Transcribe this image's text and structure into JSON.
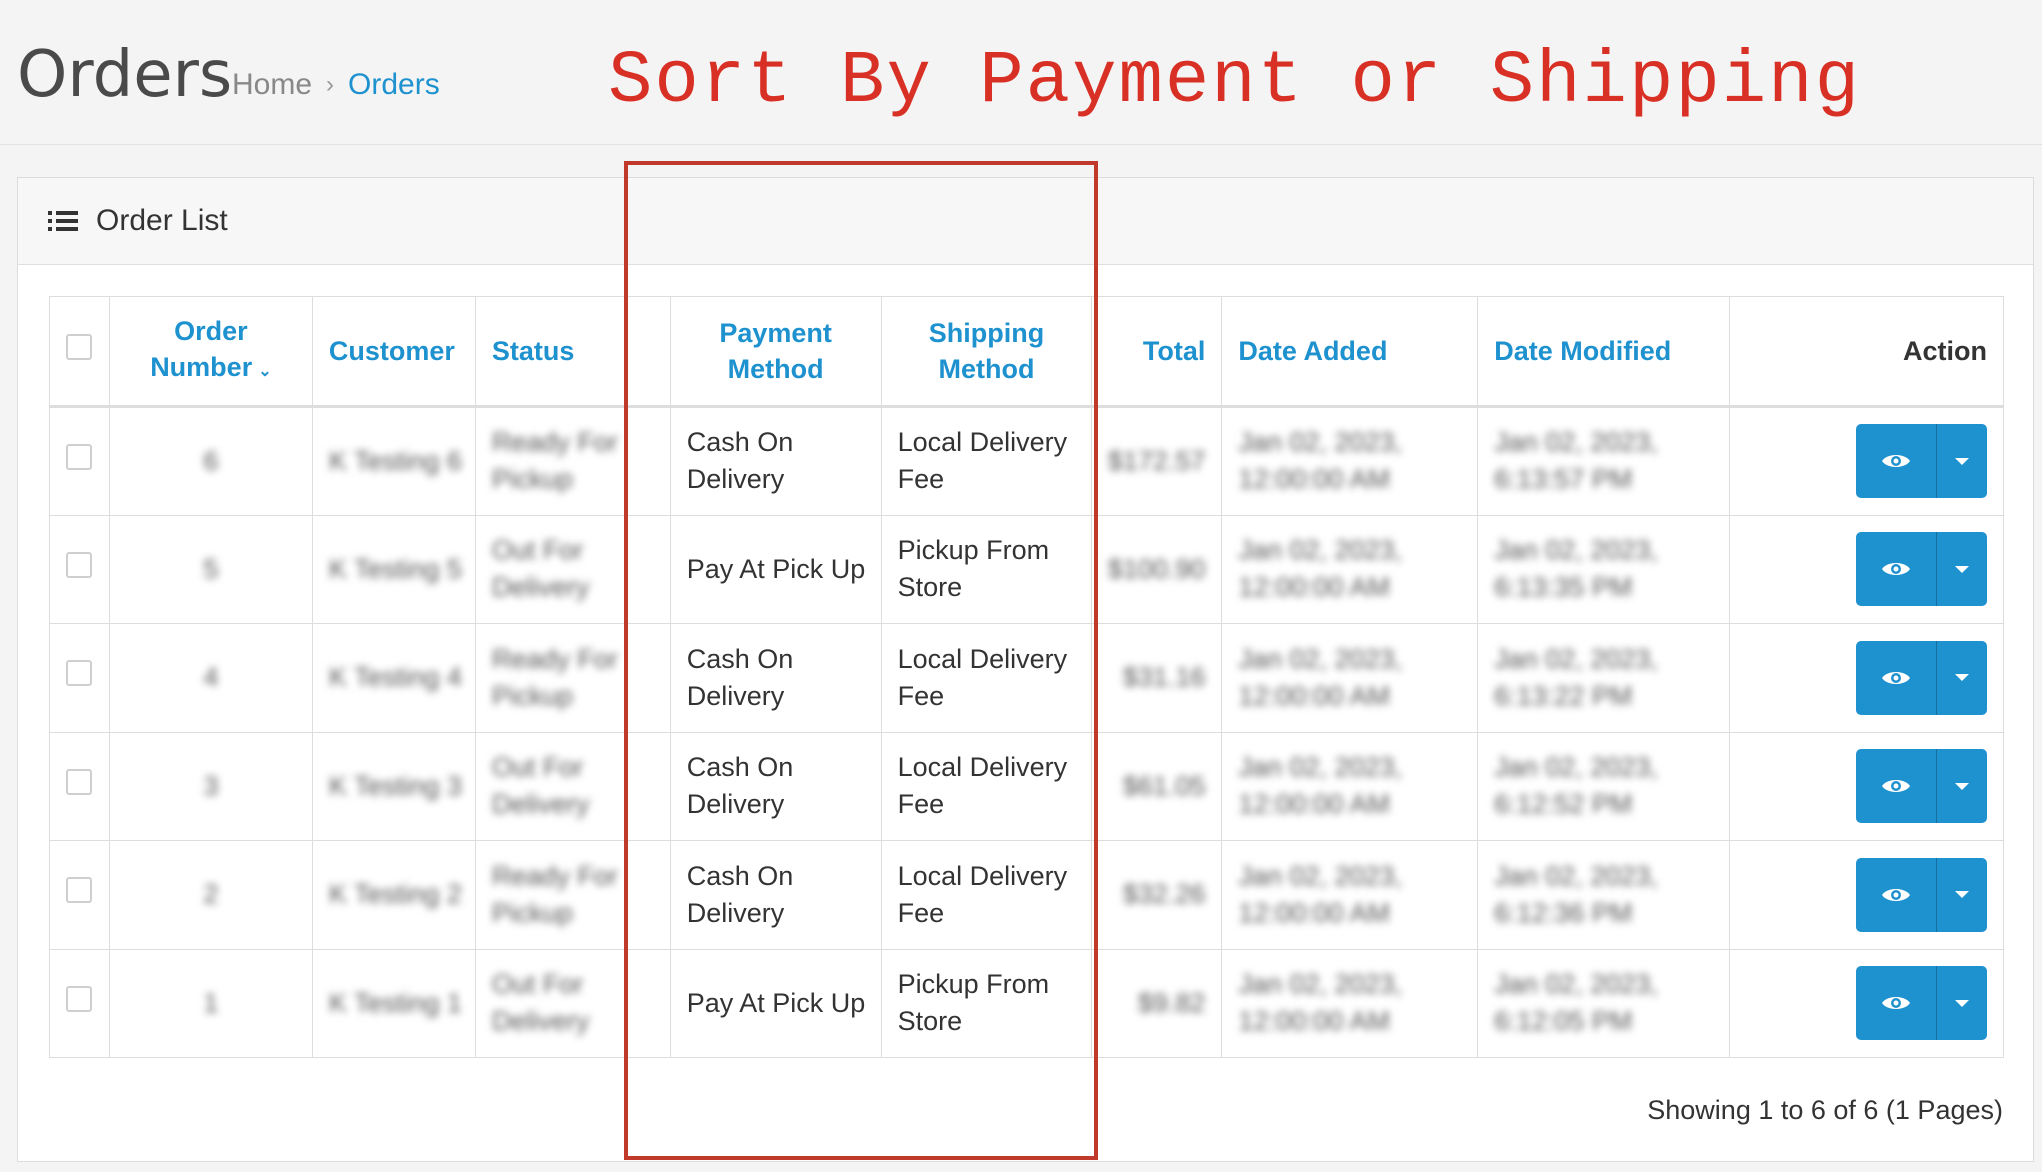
{
  "header": {
    "title": "Orders",
    "breadcrumb": [
      {
        "label": "Home"
      },
      {
        "label": "Orders"
      }
    ],
    "breadcrumb_separator": "›"
  },
  "annotation": {
    "text": "Sort By Payment or Shipping",
    "color": "#d93025"
  },
  "panel": {
    "title": "Order List",
    "icon": "list-icon"
  },
  "table": {
    "columns": {
      "order_number": "Order Number",
      "customer": "Customer",
      "status": "Status",
      "payment_method": "Payment Method",
      "shipping_method": "Shipping Method",
      "total": "Total",
      "date_added": "Date Added",
      "date_modified": "Date Modified",
      "action": "Action"
    },
    "sort_indicator": "chevron-down-icon",
    "rows": [
      {
        "order_number": "6",
        "customer": "K Testing 6",
        "status": "Ready For Pickup",
        "payment_method": "Cash On Delivery",
        "shipping_method": "Local Delivery Fee",
        "total": "$172.57",
        "date_added": "Jan 02, 2023, 12:00:00 AM",
        "date_modified": "Jan 02, 2023, 6:13:57 PM"
      },
      {
        "order_number": "5",
        "customer": "K Testing 5",
        "status": "Out For Delivery",
        "payment_method": "Pay At Pick Up",
        "shipping_method": "Pickup From Store",
        "total": "$100.90",
        "date_added": "Jan 02, 2023, 12:00:00 AM",
        "date_modified": "Jan 02, 2023, 6:13:35 PM"
      },
      {
        "order_number": "4",
        "customer": "K Testing 4",
        "status": "Ready For Pickup",
        "payment_method": "Cash On Delivery",
        "shipping_method": "Local Delivery Fee",
        "total": "$31.16",
        "date_added": "Jan 02, 2023, 12:00:00 AM",
        "date_modified": "Jan 02, 2023, 6:13:22 PM"
      },
      {
        "order_number": "3",
        "customer": "K Testing 3",
        "status": "Out For Delivery",
        "payment_method": "Cash On Delivery",
        "shipping_method": "Local Delivery Fee",
        "total": "$61.05",
        "date_added": "Jan 02, 2023, 12:00:00 AM",
        "date_modified": "Jan 02, 2023, 6:12:52 PM"
      },
      {
        "order_number": "2",
        "customer": "K Testing 2",
        "status": "Ready For Pickup",
        "payment_method": "Cash On Delivery",
        "shipping_method": "Local Delivery Fee",
        "total": "$32.26",
        "date_added": "Jan 02, 2023, 12:00:00 AM",
        "date_modified": "Jan 02, 2023, 6:12:36 PM"
      },
      {
        "order_number": "1",
        "customer": "K Testing 1",
        "status": "Out For Delivery",
        "payment_method": "Pay At Pick Up",
        "shipping_method": "Pickup From Store",
        "total": "$9.82",
        "date_added": "Jan 02, 2023, 12:00:00 AM",
        "date_modified": "Jan 02, 2023, 6:12:05 PM"
      }
    ]
  },
  "pagination": {
    "summary": "Showing 1 to 6 of 6 (1 Pages)"
  },
  "colors": {
    "accent": "#1e91cf",
    "annotation_red": "#d93025",
    "highlight_box": "#c0392b"
  }
}
